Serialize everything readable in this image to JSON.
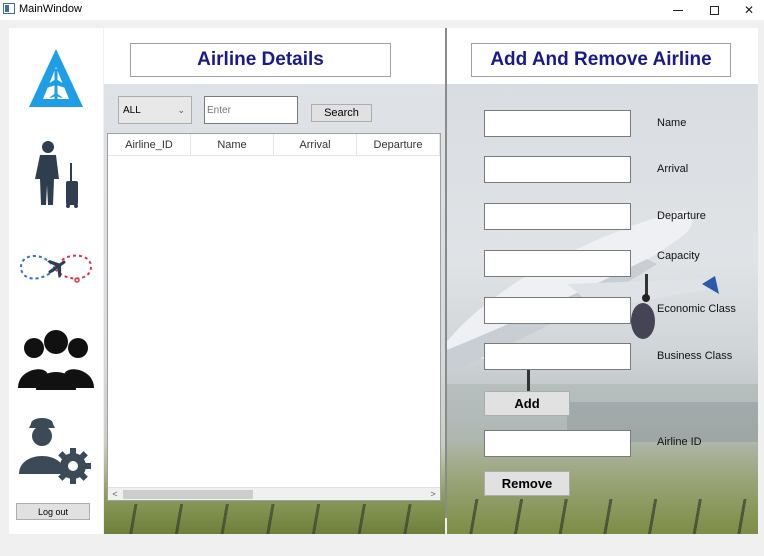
{
  "window": {
    "title": "MainWindow",
    "minimize_glyph": "",
    "maximize_glyph": "",
    "close_glyph": "✕"
  },
  "sidebar": {
    "items": [
      {
        "icon": "airline-logo-icon"
      },
      {
        "icon": "traveler-luggage-icon"
      },
      {
        "icon": "flight-route-icon"
      },
      {
        "icon": "users-group-icon"
      },
      {
        "icon": "admin-settings-icon"
      }
    ],
    "logout_label": "Log out"
  },
  "left": {
    "header": "Airline Details",
    "filter": {
      "selected": "ALL",
      "chevron": "⌄"
    },
    "search": {
      "placeholder": "Enter",
      "button_label": "Search"
    },
    "table": {
      "columns": [
        "Airline_ID",
        "Name",
        "Arrival",
        "Departure"
      ],
      "rows": [],
      "scroll_left": "<",
      "scroll_right": ">"
    }
  },
  "right": {
    "header": "Add And Remove Airline",
    "fields": {
      "name": {
        "label": "Name",
        "value": ""
      },
      "arrival": {
        "label": "Arrival",
        "value": ""
      },
      "departure": {
        "label": "Departure",
        "value": ""
      },
      "capacity": {
        "label": "Capacity",
        "value": ""
      },
      "economic_class": {
        "label": "Economic Class",
        "value": ""
      },
      "business_class": {
        "label": "Business Class",
        "value": ""
      },
      "airline_id": {
        "label": "Airline ID",
        "value": ""
      }
    },
    "add_label": "Add",
    "remove_label": "Remove"
  },
  "colors": {
    "header_text": "#1a1a8c",
    "logo_blue": "#1e9ee6",
    "icon_dark": "#2e3e4e"
  }
}
